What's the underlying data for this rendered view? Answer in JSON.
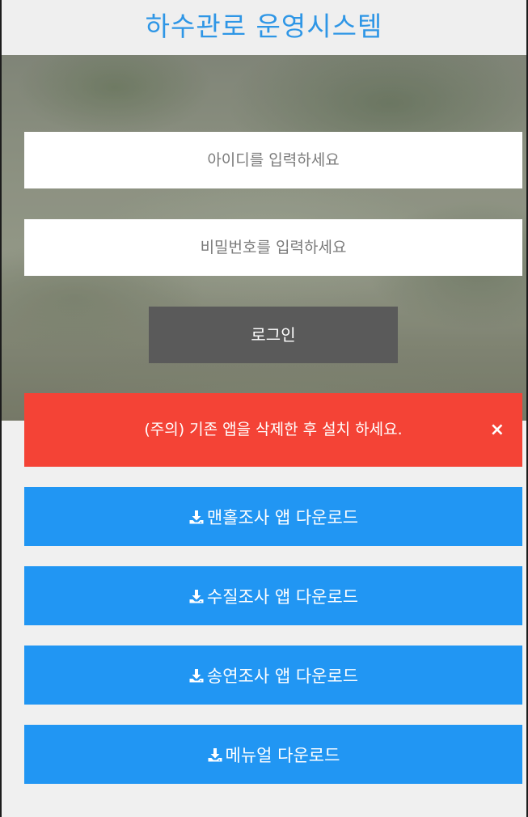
{
  "header": {
    "title": "하수관로 운영시스템"
  },
  "login": {
    "id_placeholder": "아이디를 입력하세요",
    "password_placeholder": "비밀번호를 입력하세요",
    "submit_label": "로그인"
  },
  "alert": {
    "message": "(주의) 기존 앱을 삭제한 후 설치 하세요.",
    "close_glyph": "×",
    "color": "#f44336"
  },
  "downloads": [
    {
      "label": "맨홀조사 앱 다운로드",
      "icon": "download-icon"
    },
    {
      "label": "수질조사 앱 다운로드",
      "icon": "download-icon"
    },
    {
      "label": "송연조사 앱 다운로드",
      "icon": "download-icon"
    },
    {
      "label": "메뉴얼 다운로드",
      "icon": "download-icon"
    }
  ],
  "colors": {
    "title": "#2e96e6",
    "download_button": "#2196f3",
    "login_button": "#5a5a5a"
  }
}
